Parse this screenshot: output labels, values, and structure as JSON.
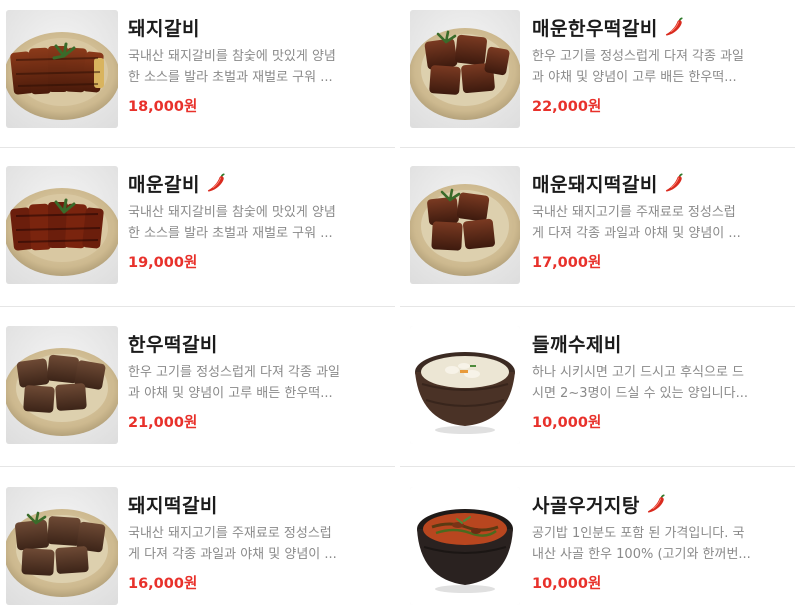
{
  "menu_items": [
    {
      "name": "돼지갈비",
      "spicy": false,
      "desc_line1": "국내산 돼지갈비를 참숯에 맛있게 양념",
      "desc_line2": "한 소스를 발라 초벌과 재벌로 구워 ...",
      "price": "18,000원",
      "image": "pork-galbi-plate"
    },
    {
      "name": "매운한우떡갈비",
      "spicy": true,
      "desc_line1": "한우 고기를 정성스럽게 다져 각종 과일",
      "desc_line2": "과 야채 및 양념이 고루 배든 한우떡...",
      "price": "22,000원",
      "image": "spicy-hanwoo-tteokgalbi-plate"
    },
    {
      "name": "매운갈비",
      "spicy": true,
      "desc_line1": "국내산 돼지갈비를 참숯에 맛있게 양념",
      "desc_line2": "한 소스를 발라 초벌과 재벌로 구워 ...",
      "price": "19,000원",
      "image": "spicy-galbi-plate"
    },
    {
      "name": "매운돼지떡갈비",
      "spicy": true,
      "desc_line1": "국내산 돼지고기를 주재료로 정성스럽",
      "desc_line2": "게 다져 각종 과일과 야채 및 양념이 ...",
      "price": "17,000원",
      "image": "spicy-pork-tteokgalbi-plate"
    },
    {
      "name": "한우떡갈비",
      "spicy": false,
      "desc_line1": "한우 고기를 정성스럽게 다져 각종 과일",
      "desc_line2": "과 야채 및 양념이 고루 배든 한우떡...",
      "price": "21,000원",
      "image": "hanwoo-tteokgalbi-plate"
    },
    {
      "name": "들깨수제비",
      "spicy": false,
      "desc_line1": "하나 시키시면 고기 드시고 후식으로 드",
      "desc_line2": "시면 2~3명이 드실 수 있는 양입니다...",
      "price": "10,000원",
      "image": "perilla-sujebi-bowl"
    },
    {
      "name": "돼지떡갈비",
      "spicy": false,
      "desc_line1": "국내산 돼지고기를 주재료로 정성스럽",
      "desc_line2": "게 다져 각종 과일과 야채 및 양념이 ...",
      "price": "16,000원",
      "image": "pork-tteokgalbi-plate"
    },
    {
      "name": "사골우거지탕",
      "spicy": true,
      "desc_line1": "공기밥 1인분도 포함 된 가격입니다. 국",
      "desc_line2": "내산 사골 한우 100% (고기와 한꺼번...",
      "price": "10,000원",
      "image": "sagol-ugeoji-tang-bowl"
    }
  ],
  "colors": {
    "price": "#e8312b",
    "title": "#1b1b1b",
    "description": "#8a8a8a",
    "divider": "#e6e6e6",
    "chili": "#d92b1f"
  }
}
